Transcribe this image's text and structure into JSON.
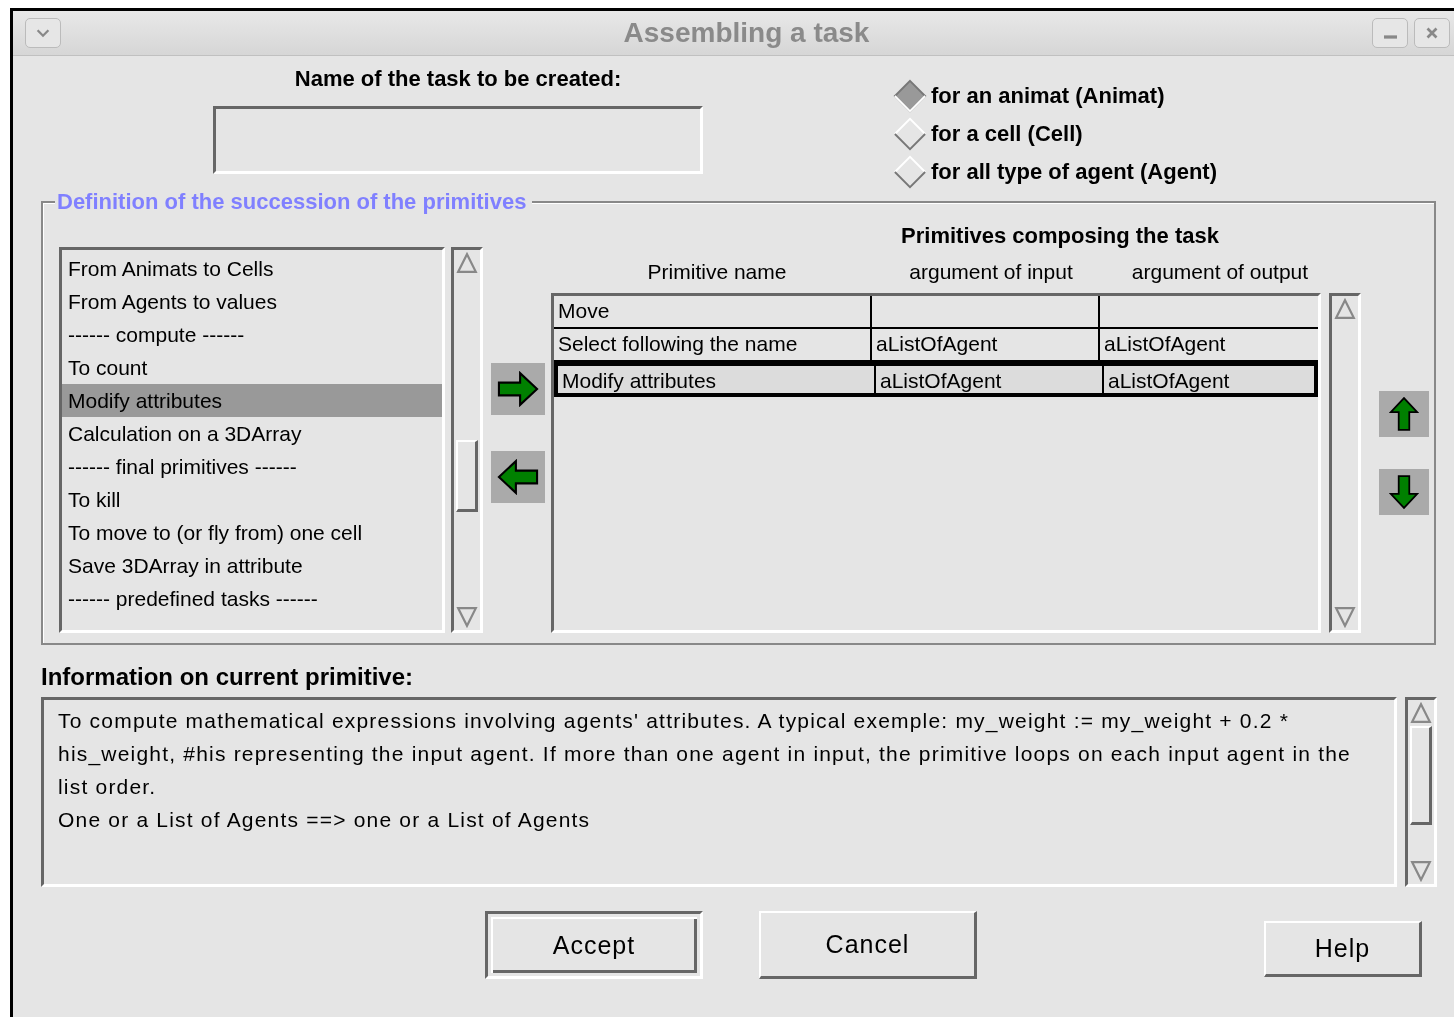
{
  "window": {
    "title": "Assembling a task"
  },
  "task_name": {
    "label": "Name of the task to be created:"
  },
  "agent_types": [
    {
      "label": "for an animat (Animat)",
      "selected": true
    },
    {
      "label": "for a cell (Cell)",
      "selected": false
    },
    {
      "label": "for all type of agent (Agent)",
      "selected": false
    }
  ],
  "succession": {
    "legend": "Definition of the succession of the primitives",
    "primitives": [
      {
        "label": "From Animats to Cells",
        "selected": false
      },
      {
        "label": "From Agents to values",
        "selected": false
      },
      {
        "label": "------ compute ------",
        "selected": false
      },
      {
        "label": "To count",
        "selected": false
      },
      {
        "label": "Modify attributes",
        "selected": true
      },
      {
        "label": "Calculation on a 3DArray",
        "selected": false
      },
      {
        "label": "------ final primitives ------",
        "selected": false
      },
      {
        "label": "To kill",
        "selected": false
      },
      {
        "label": "To move to (or fly from) one cell",
        "selected": false
      },
      {
        "label": "Save 3DArray in attribute",
        "selected": false
      },
      {
        "label": "------ predefined tasks ------",
        "selected": false
      }
    ],
    "task_table": {
      "title": "Primitives composing the task",
      "columns": [
        "Primitive name",
        "argument of input",
        "argument of output"
      ],
      "rows": [
        {
          "cells": [
            "Move"
          ],
          "selected": false
        },
        {
          "cells": [
            "Select following the name",
            "aListOfAgent",
            "aListOfAgent"
          ],
          "selected": false
        },
        {
          "cells": [
            "Modify attributes",
            "aListOfAgent",
            "aListOfAgent"
          ],
          "selected": true
        }
      ]
    }
  },
  "info": {
    "heading": "Information on current primitive:",
    "paragraphs": [
      "To compute mathematical expressions involving agents' attributes. A typical exemple: my_weight := my_weight + 0.2 * his_weight, #his representing the input agent. If more than one agent in input, the primitive loops on each input agent in the list order.",
      "One or a List of Agents ==> one or a List of Agents"
    ]
  },
  "buttons": [
    {
      "label": "Accept",
      "default": true
    },
    {
      "label": "Cancel",
      "default": false
    },
    {
      "label": "Help",
      "default": false
    }
  ]
}
